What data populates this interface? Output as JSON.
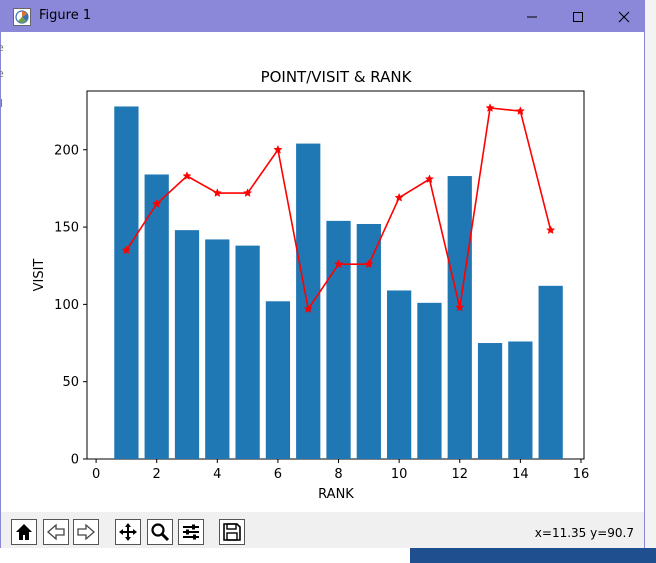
{
  "window": {
    "title": "Figure 1",
    "app_icon": "matplotlib-figure-icon",
    "controls": [
      "minimize-icon",
      "maximize-icon",
      "close-icon"
    ]
  },
  "background": {
    "left_fragments": [
      "e",
      "e",
      "il"
    ]
  },
  "toolbar": {
    "buttons": [
      "home-icon",
      "back-icon",
      "forward-icon",
      "pan-icon",
      "zoom-icon",
      "configure-subplots-icon",
      "save-icon"
    ],
    "coordinates": "x=11.35 y=90.7"
  },
  "chart_data": {
    "type": "bar",
    "title": "POINT/VISIT & RANK",
    "xlabel": "RANK",
    "ylabel": "VISIT",
    "xlim": [
      -0.3,
      16.1
    ],
    "ylim": [
      0,
      238
    ],
    "xticks": [
      0,
      2,
      4,
      6,
      8,
      10,
      12,
      14,
      16
    ],
    "yticks": [
      0,
      50,
      100,
      150,
      200
    ],
    "bar_color": "#1f77b4",
    "line_color": "#ff0000",
    "x": [
      1,
      2,
      3,
      4,
      5,
      6,
      7,
      8,
      9,
      10,
      11,
      12,
      13,
      14,
      15
    ],
    "series": [
      {
        "kind": "bar",
        "values": [
          228,
          184,
          148,
          142,
          138,
          102,
          204,
          154,
          152,
          109,
          101,
          183,
          75,
          76,
          112
        ]
      },
      {
        "kind": "line",
        "marker": "star",
        "values": [
          135,
          165,
          183,
          172,
          172,
          200,
          97,
          126,
          126,
          169,
          181,
          98,
          227,
          225,
          148
        ]
      }
    ]
  }
}
